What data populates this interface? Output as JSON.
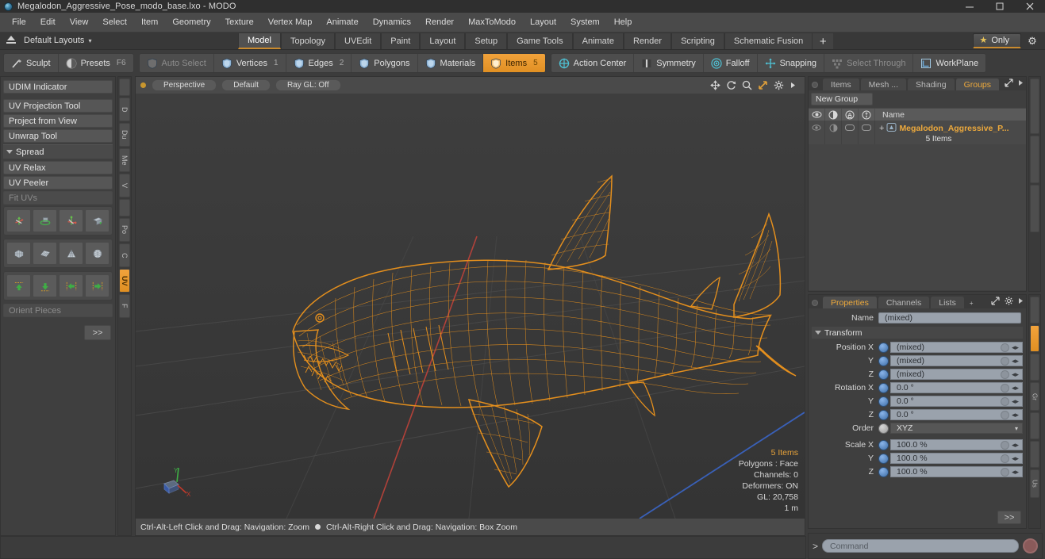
{
  "window": {
    "title": "Megalodon_Aggressive_Pose_modo_base.lxo - MODO",
    "app_icon": "modo-sphere-icon",
    "minimize": "minimize-icon",
    "maximize": "maximize-icon",
    "close": "close-icon"
  },
  "menubar": {
    "items": [
      "File",
      "Edit",
      "View",
      "Select",
      "Item",
      "Geometry",
      "Texture",
      "Vertex Map",
      "Animate",
      "Dynamics",
      "Render",
      "MaxToModo",
      "Layout",
      "System",
      "Help"
    ]
  },
  "layoutbar": {
    "layouts_label": "Default Layouts",
    "caret": "▾",
    "tabs": [
      "Model",
      "Topology",
      "UVEdit",
      "Paint",
      "Layout",
      "Setup",
      "Game Tools",
      "Animate",
      "Render",
      "Scripting",
      "Schematic Fusion"
    ],
    "active_tab": "Model",
    "plus": "+",
    "only_label": "Only",
    "star": "★",
    "gear": "⚙"
  },
  "toolbar": {
    "group1": [
      {
        "label": "Sculpt",
        "icon": "brush-icon",
        "state": "normal"
      },
      {
        "label": "Presets",
        "icon": "sphere-icon",
        "state": "normal",
        "shortcut": "F6"
      }
    ],
    "group2": [
      {
        "label": "Auto Select",
        "icon": "shield-icon",
        "state": "dim"
      },
      {
        "label": "Vertices",
        "icon": "shield-icon",
        "state": "normal",
        "num": "1"
      },
      {
        "label": "Edges",
        "icon": "shield-icon",
        "state": "normal",
        "num": "2"
      },
      {
        "label": "Polygons",
        "icon": "shield-icon",
        "state": "normal",
        "num": ""
      },
      {
        "label": "Materials",
        "icon": "shield-icon",
        "state": "normal",
        "num": ""
      },
      {
        "label": "Items",
        "icon": "shield-icon",
        "state": "selected",
        "num": "5"
      }
    ],
    "group3": [
      {
        "label": "Action Center",
        "icon": "crosshair-icon",
        "state": "normal"
      },
      {
        "label": "Symmetry",
        "icon": "mirror-icon",
        "state": "normal"
      },
      {
        "label": "Falloff",
        "icon": "target-icon",
        "state": "normal"
      },
      {
        "label": "Snapping",
        "icon": "snap-icon",
        "state": "normal"
      },
      {
        "label": "Select Through",
        "icon": "select-through-icon",
        "state": "dim"
      },
      {
        "label": "WorkPlane",
        "icon": "workplane-icon",
        "state": "normal"
      }
    ]
  },
  "left_panel": {
    "buttons_top": [
      {
        "label": "UDIM Indicator",
        "state": "normal"
      }
    ],
    "buttons_mid": [
      {
        "label": "UV Projection Tool",
        "state": "normal"
      },
      {
        "label": "Project from View",
        "state": "normal"
      },
      {
        "label": "Unwrap Tool",
        "state": "normal"
      }
    ],
    "section_spread": "Spread",
    "buttons_bottom": [
      {
        "label": "UV Relax",
        "state": "normal"
      },
      {
        "label": "UV Peeler",
        "state": "normal"
      },
      {
        "label": "Fit UVs",
        "state": "dim"
      }
    ],
    "icon_grid_1": [
      "move-uv-icon",
      "rotate-uv-icon",
      "scale-uv-icon",
      "flip-uv-icon"
    ],
    "icon_grid_2": [
      "unwrap-mesh-icon",
      "flatten-grid-icon",
      "cone-unwrap-icon",
      "sphere-unwrap-icon"
    ],
    "icon_grid_3": [
      "align-up-icon",
      "align-down-icon",
      "align-left-icon",
      "align-right-icon"
    ],
    "orient_pieces": "Orient Pieces",
    "more_button": ">>",
    "vertical_tabs": [
      {
        "label": "",
        "active": false
      },
      {
        "label": "D",
        "active": false
      },
      {
        "label": "Du",
        "active": false
      },
      {
        "label": "Me",
        "active": false
      },
      {
        "label": "V",
        "active": false
      },
      {
        "label": "",
        "active": false
      },
      {
        "label": "Po",
        "active": false
      },
      {
        "label": "C",
        "active": false
      },
      {
        "label": "UV",
        "active": true
      },
      {
        "label": "F",
        "active": false
      }
    ]
  },
  "viewport": {
    "mode_dot": "viewport-active-dot",
    "pills": [
      "Perspective",
      "Default",
      "Ray GL: Off"
    ],
    "header_icons": [
      "pan-icon",
      "rotate-icon",
      "zoom-icon",
      "fit-icon",
      "options-gear-icon",
      "expand-arrow-icon"
    ],
    "stats": {
      "items": "5 Items",
      "polygons": "Polygons : Face",
      "channels": "Channels: 0",
      "deformers": "Deformers: ON",
      "gl": "GL: 20,758",
      "scale": "1 m"
    },
    "gizmo": "axis-gizmo",
    "footer_left": "Ctrl-Alt-Left Click and Drag: Navigation: Zoom",
    "footer_right": "Ctrl-Alt-Right Click and Drag: Navigation: Box Zoom",
    "model_name": "megalodon-shark-wireframe",
    "wire_color": "#e8911d"
  },
  "right_panel": {
    "top": {
      "tabs": [
        {
          "label": "Items",
          "active": false
        },
        {
          "label": "Mesh ...",
          "active": false
        },
        {
          "label": "Shading",
          "active": false
        },
        {
          "label": "Groups",
          "active": true
        }
      ],
      "caret": "▾",
      "expand_icon": "expand-icon",
      "arrow_icon": "arrow-right-icon",
      "new_group_button": "New Group",
      "list_columns": [
        "eye-icon",
        "shade-icon",
        "lock-icon",
        "render-icon",
        "Name"
      ],
      "rows": [
        {
          "name": "Megalodon_Aggressive_P...",
          "sub": "5 Items",
          "icon": "group-icon",
          "expander": "+"
        }
      ]
    },
    "properties": {
      "tabs": [
        {
          "label": "Properties",
          "active": true
        },
        {
          "label": "Channels",
          "active": false
        },
        {
          "label": "Lists",
          "active": false
        }
      ],
      "plus": "+",
      "expand_icon": "expand-icon",
      "gear_icon": "gear-icon",
      "arrow_icon": "arrow-right-icon",
      "name_label": "Name",
      "name_value": "(mixed)",
      "section_transform": "Transform",
      "fields": [
        {
          "label": "Position X",
          "value": "(mixed)",
          "knob": "blue"
        },
        {
          "label": "Y",
          "value": "(mixed)",
          "knob": "blue"
        },
        {
          "label": "Z",
          "value": "(mixed)",
          "knob": "blue"
        },
        {
          "label": "Rotation X",
          "value": "0.0 °",
          "knob": "blue"
        },
        {
          "label": "Y",
          "value": "0.0 °",
          "knob": "blue"
        },
        {
          "label": "Z",
          "value": "0.0 °",
          "knob": "blue"
        },
        {
          "label": "Order",
          "value": "XYZ",
          "knob": "gray",
          "dropdown": true
        },
        {
          "label": "Scale X",
          "value": "100.0 %",
          "knob": "blue"
        },
        {
          "label": "Y",
          "value": "100.0 %",
          "knob": "blue"
        },
        {
          "label": "Z",
          "value": "100.0 %",
          "knob": "blue"
        }
      ],
      "more_button": ">>",
      "vertical_tabs": [
        {
          "label": "",
          "active": false
        },
        {
          "label": "",
          "active": true
        },
        {
          "label": "",
          "active": false
        },
        {
          "label": "Gr",
          "active": false
        },
        {
          "label": "",
          "active": false
        },
        {
          "label": "",
          "active": false
        },
        {
          "label": "Us",
          "active": false
        }
      ]
    }
  },
  "command_bar": {
    "prompt": "&gt;",
    "placeholder": "Command",
    "record_button": "record-icon"
  },
  "colors": {
    "accent": "#eda93c",
    "wireframe": "#e8911d",
    "panel_bg": "#3f3f3f",
    "toolbar_bg": "#3c3c3c",
    "field_bg": "#9aa2ac"
  }
}
